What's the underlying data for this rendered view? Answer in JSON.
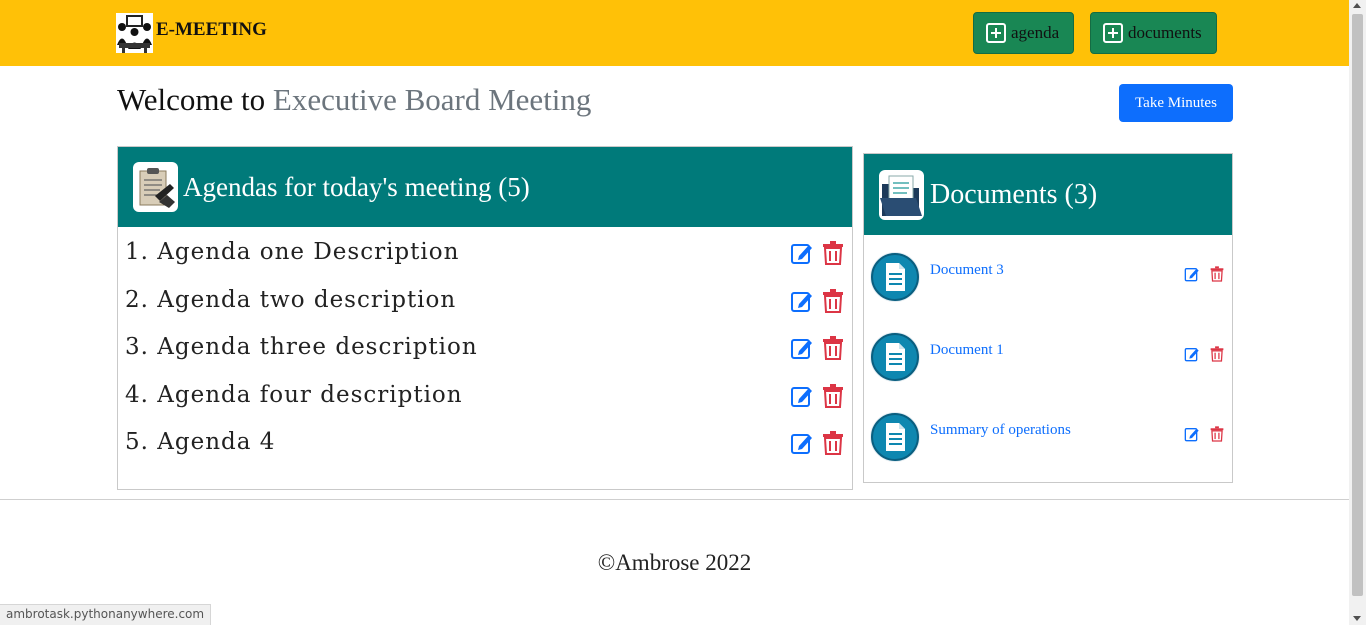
{
  "navbar": {
    "brand": "E-MEETING",
    "buttons": [
      {
        "label": "agenda",
        "icon": "plus-square-icon"
      },
      {
        "label": "documents",
        "icon": "plus-square-icon"
      }
    ],
    "background": "#ffc107",
    "button_color": "#198754"
  },
  "welcome": {
    "prefix": "Welcome to",
    "meeting_name": "Executive Board Meeting",
    "take_minutes_label": "Take Minutes"
  },
  "agendas": {
    "title": "Agendas for today's meeting (5)",
    "items": [
      {
        "text": "1. Agenda one Description"
      },
      {
        "text": "2. Agenda two description"
      },
      {
        "text": "3. Agenda three description"
      },
      {
        "text": "4. Agenda four description"
      },
      {
        "text": "5. Agenda 4"
      }
    ]
  },
  "documents": {
    "title": "Documents (3)",
    "items": [
      {
        "name": "Document 3"
      },
      {
        "name": "Document 1"
      },
      {
        "name": "Summary of operations"
      }
    ]
  },
  "footer": {
    "text": "©Ambrose 2022"
  },
  "status_bar": {
    "url": "ambrotask.pythonanywhere.com"
  },
  "colors": {
    "header_teal": "#007a7a",
    "edit_blue": "#0d6efd",
    "delete_red": "#dc3545"
  }
}
